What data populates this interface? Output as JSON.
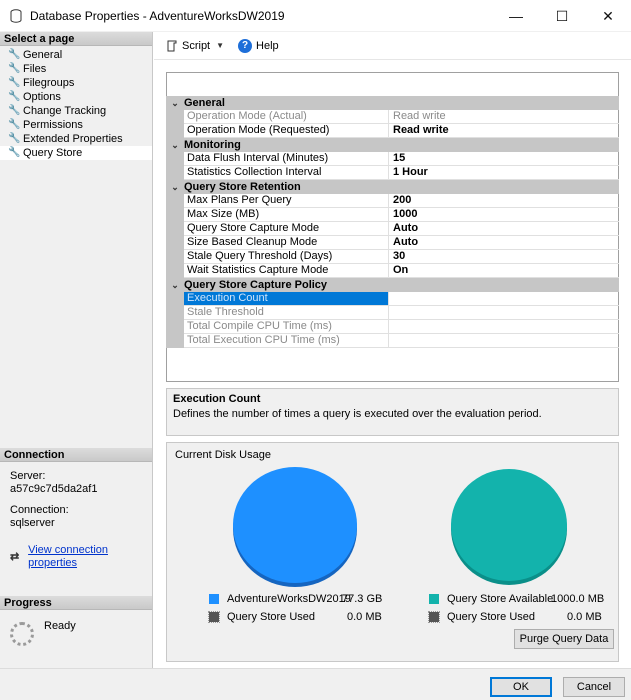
{
  "window": {
    "title": "Database Properties - AdventureWorksDW2019",
    "controls": {
      "minimize": "—",
      "maximize": "☐",
      "close": "✕"
    }
  },
  "left": {
    "select_header": "Select a page",
    "pages": [
      "General",
      "Files",
      "Filegroups",
      "Options",
      "Change Tracking",
      "Permissions",
      "Extended Properties",
      "Query Store"
    ],
    "connection_header": "Connection",
    "server_label": "Server:",
    "server_value": "a57c9c7d5da2af1",
    "connection_label": "Connection:",
    "connection_value": "sqlserver",
    "view_link": "View connection properties",
    "progress_header": "Progress",
    "progress_status": "Ready"
  },
  "toolbar": {
    "script_label": "Script",
    "help_label": "Help"
  },
  "properties": {
    "categories": [
      {
        "name": "General",
        "rows": [
          {
            "name": "Operation Mode (Actual)",
            "value": "Read write",
            "readonly": true
          },
          {
            "name": "Operation Mode (Requested)",
            "value": "Read write",
            "readonly": false
          }
        ]
      },
      {
        "name": "Monitoring",
        "rows": [
          {
            "name": "Data Flush Interval (Minutes)",
            "value": "15",
            "readonly": false
          },
          {
            "name": "Statistics Collection Interval",
            "value": "1 Hour",
            "readonly": false
          }
        ]
      },
      {
        "name": "Query Store Retention",
        "rows": [
          {
            "name": "Max Plans Per Query",
            "value": "200",
            "readonly": false
          },
          {
            "name": "Max Size (MB)",
            "value": "1000",
            "readonly": false
          },
          {
            "name": "Query Store Capture Mode",
            "value": "Auto",
            "readonly": false
          },
          {
            "name": "Size Based Cleanup Mode",
            "value": "Auto",
            "readonly": false
          },
          {
            "name": "Stale Query Threshold (Days)",
            "value": "30",
            "readonly": false
          },
          {
            "name": "Wait Statistics Capture Mode",
            "value": "On",
            "readonly": false
          }
        ]
      },
      {
        "name": "Query Store Capture Policy",
        "rows": [
          {
            "name": "Execution Count",
            "value": "",
            "readonly": true,
            "selected": true
          },
          {
            "name": "Stale Threshold",
            "value": "",
            "readonly": true
          },
          {
            "name": "Total Compile CPU Time (ms)",
            "value": "",
            "readonly": true
          },
          {
            "name": "Total Execution CPU Time (ms)",
            "value": "",
            "readonly": true
          }
        ]
      }
    ]
  },
  "description": {
    "title": "Execution Count",
    "text": "Defines the number of times a query is executed over the evaluation period."
  },
  "disk": {
    "label": "Current Disk Usage",
    "left_pie": {
      "color": "#1e90ff"
    },
    "right_pie": {
      "color": "#13b3ac"
    },
    "legend": [
      {
        "label": "AdventureWorksDW2019",
        "value": "77.3 GB",
        "color": "#1e90ff"
      },
      {
        "label": "Query Store Used",
        "value": "0.0 MB",
        "color": "#555555"
      },
      {
        "label": "Query Store Available",
        "value": "1000.0 MB",
        "color": "#13b3ac"
      },
      {
        "label": "Query Store Used",
        "value": "0.0 MB",
        "color": "#555555"
      }
    ],
    "purge_label": "Purge Query Data"
  },
  "footer": {
    "ok_label": "OK",
    "cancel_label": "Cancel"
  }
}
